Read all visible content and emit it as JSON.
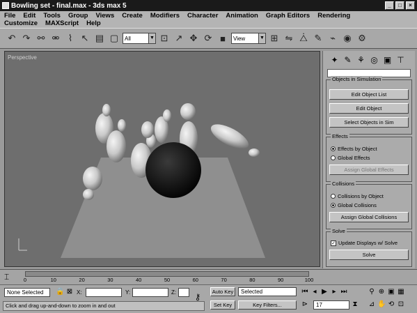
{
  "window": {
    "title": "Bowling set - final.max - 3ds max 5",
    "buttons": [
      "_",
      "□",
      "×"
    ]
  },
  "menu": {
    "row1": [
      "File",
      "Edit",
      "Tools",
      "Group",
      "Views",
      "Create",
      "Modifiers",
      "Character",
      "Animation",
      "Graph Editors",
      "Rendering"
    ],
    "row2": [
      "Customize",
      "MAXScript",
      "Help"
    ]
  },
  "toolbar": {
    "selection_filter": "All",
    "ref_coord": "View"
  },
  "viewport": {
    "label": "Perspective"
  },
  "command_panel": {
    "tab_icons": [
      "create-icon",
      "modify-icon",
      "hierarchy-icon",
      "motion-icon",
      "display-icon",
      "utilities-icon"
    ],
    "sim_rollout": {
      "title": "Objects in Simulation",
      "buttons": [
        "Edit Object List",
        "Edit Object",
        "Select Objects in Sim"
      ]
    },
    "effects_rollout": {
      "title": "Effects",
      "option1": "Effects by Object",
      "option2": "Global Effects",
      "button": "Assign Global Effects"
    },
    "collisions_rollout": {
      "title": "Collisions",
      "option1": "Collisions by Object",
      "option2": "Global Collisions",
      "button": "Assign Global Collisions"
    },
    "solve_rollout": {
      "title": "Solve",
      "check": "Update Displays w/ Solve",
      "button": "Solve"
    }
  },
  "timeline": {
    "ticks": [
      "0",
      "10",
      "20",
      "30",
      "40",
      "50",
      "60",
      "70",
      "80",
      "90",
      "100"
    ]
  },
  "status": {
    "selection": "None Selected",
    "x_label": "X:",
    "y_label": "Y:",
    "z_label": "Z:",
    "auto_key": "Auto Key",
    "set_key": "Set Key",
    "key_filter": "Selected",
    "key_filters_button": "Key Filters...",
    "frame": "17",
    "prompt": "Click and drag up-and-down to zoom in and out"
  }
}
